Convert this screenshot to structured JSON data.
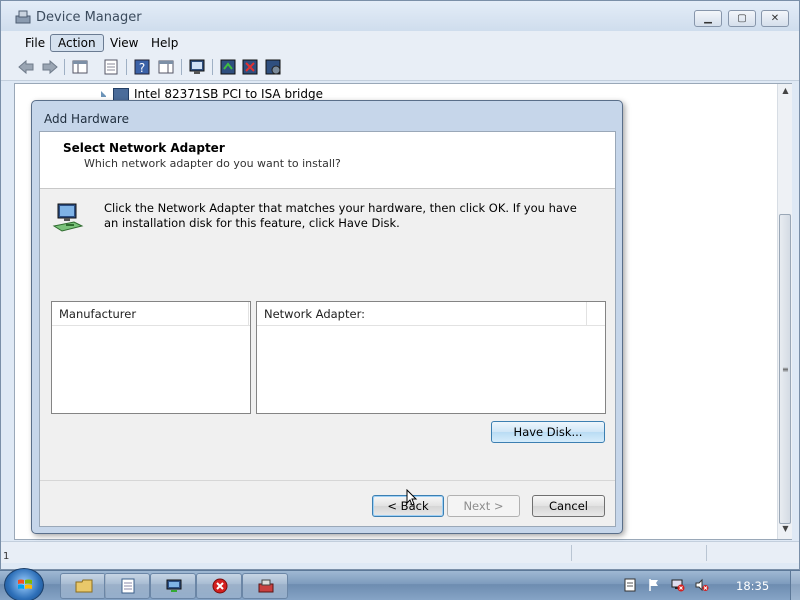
{
  "window": {
    "title": "Device Manager",
    "icon": "device-manager-icon",
    "minimize_glyph": "▁",
    "maximize_glyph": "▢",
    "close_glyph": "✕"
  },
  "menubar": {
    "items": [
      "File",
      "Action",
      "View",
      "Help"
    ]
  },
  "toolbar": {
    "icons": [
      "back-arrow-icon",
      "forward-arrow-icon",
      "show-hide-console-tree-icon",
      "properties-icon",
      "help-icon",
      "show-action-pane-icon",
      "update-driver-icon",
      "scan-hardware-icon",
      "uninstall-device-icon",
      "disable-device-icon",
      "enable-device-icon"
    ]
  },
  "tree": {
    "visible_item": "Intel 82371SB PCI to ISA bridge"
  },
  "dialog": {
    "title": "Add Hardware",
    "heading": "Select Network Adapter",
    "subheading": "Which network adapter do you want to install?",
    "instruction": "Click the Network Adapter that matches your hardware, then click OK. If you have an installation disk for this feature, click Have Disk.",
    "manufacturer_header": "Manufacturer",
    "adapter_header": "Network Adapter:",
    "have_disk_label": "Have Disk...",
    "back_label": "< Back",
    "next_label": "Next >",
    "cancel_label": "Cancel"
  },
  "left_edge_text": "1",
  "taskbar": {
    "tasks": [
      "windows-explorer-icon",
      "notepad-icon",
      "network-icon",
      "error-icon",
      "device-manager-icon"
    ],
    "tray_icons": [
      "document-icon",
      "action-center-flag-icon",
      "network-disconnected-icon",
      "speaker-muted-icon"
    ],
    "clock": "18:35"
  }
}
